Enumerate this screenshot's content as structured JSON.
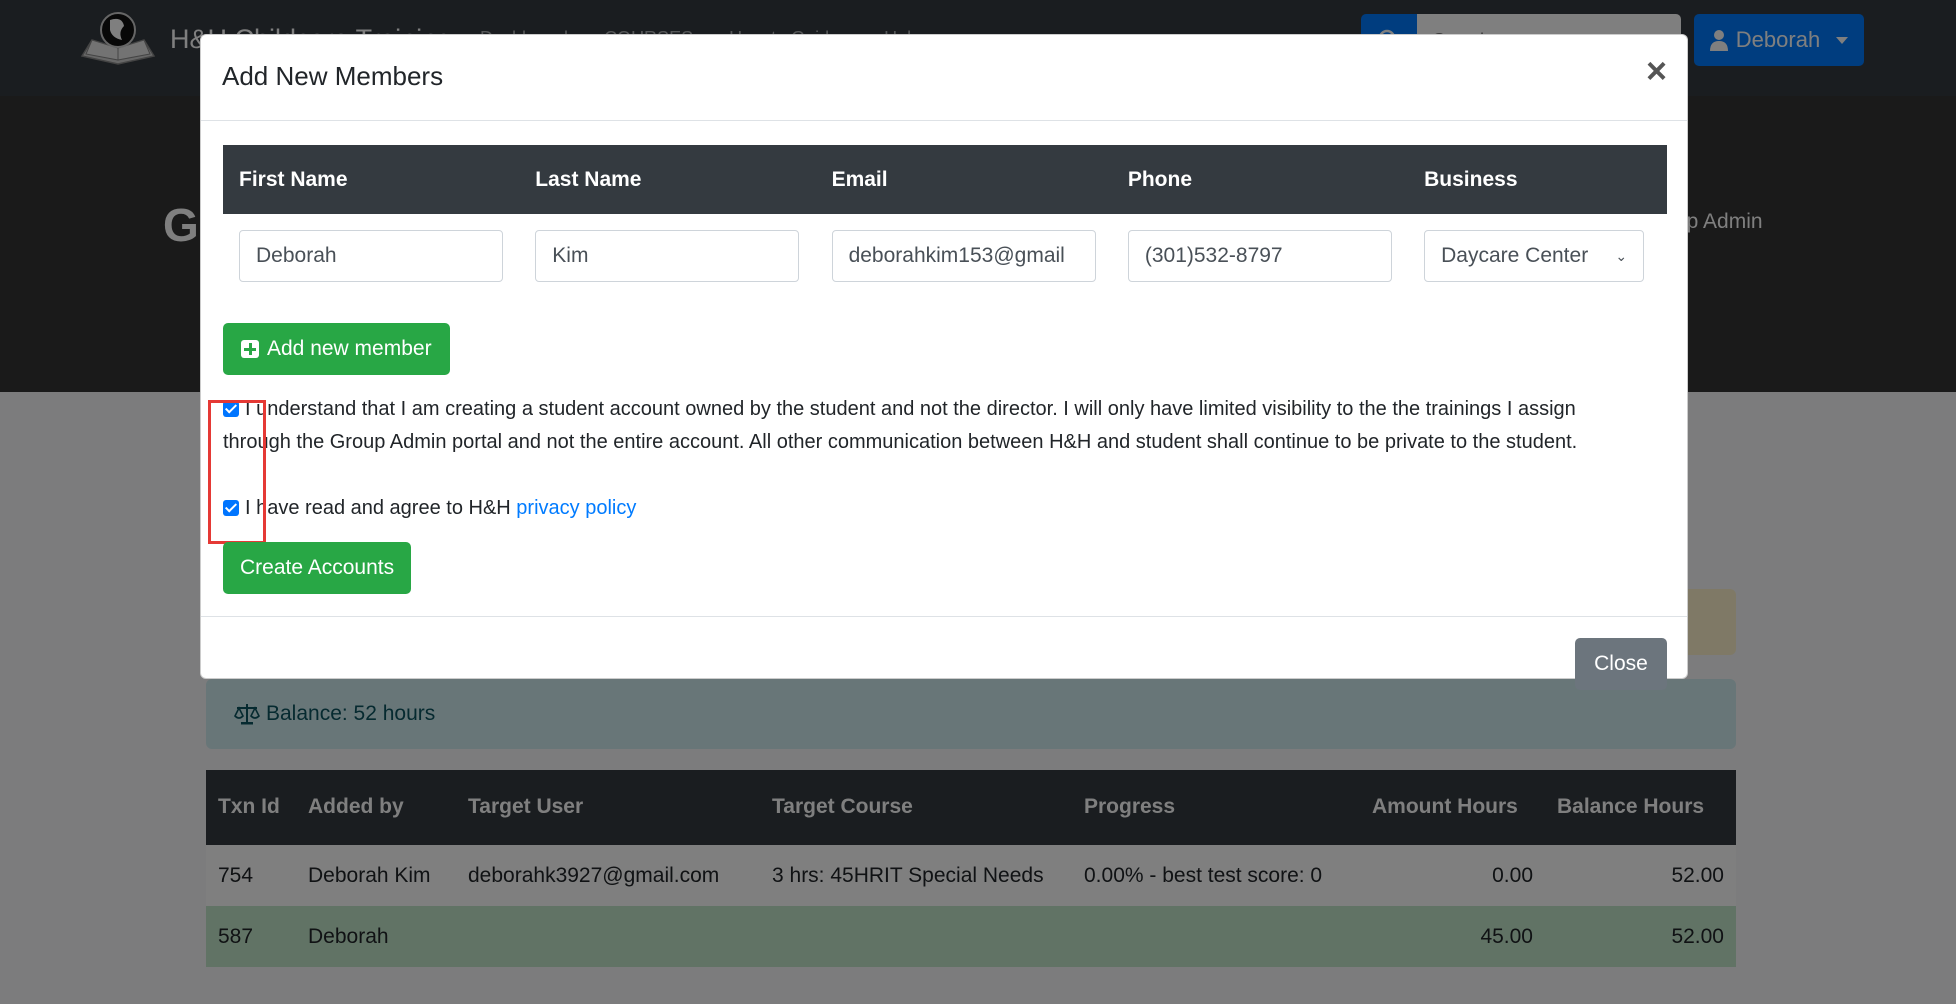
{
  "navbar": {
    "brand_name": "H&H Childcare Training",
    "links": [
      "Dashboard",
      "COURSES",
      "How-to Guides",
      "Help"
    ],
    "search_placeholder": "Search...",
    "user_label": "Deborah"
  },
  "hero": {
    "title": "Group Admin",
    "role": "Group Admin"
  },
  "balance_alert": {
    "icon": "balance-scale-icon",
    "text": "Balance: 52 hours"
  },
  "transactions": {
    "columns": [
      "Txn Id",
      "Added by",
      "Target User",
      "Target Course",
      "Progress",
      "Amount Hours",
      "Balance Hours"
    ],
    "rows": [
      {
        "txn_id": "754",
        "added_by": "Deborah Kim",
        "target_user": "deborahk3927@gmail.com",
        "target_course": "3 hrs: 45HRIT Special Needs",
        "progress": "0.00% - best test score: 0",
        "amount_hours": "0.00",
        "balance_hours": "52.00"
      },
      {
        "txn_id": "587",
        "added_by": "Deborah",
        "target_user": "",
        "target_course": "",
        "progress": "",
        "amount_hours": "45.00",
        "balance_hours": "52.00"
      }
    ]
  },
  "modal": {
    "title": "Add New Members",
    "close_symbol": "×",
    "columns": [
      "First Name",
      "Last Name",
      "Email",
      "Phone",
      "Business"
    ],
    "row": {
      "first_name": "Deborah",
      "last_name": "Kim",
      "email": "deborahkim153@gmail",
      "phone": "(301)532-8797",
      "business": "Daycare Center"
    },
    "add_member_label": "Add new member",
    "consent_text": "I understand that I am creating a student account owned by the student and not the director. I will only have limited visibility to the the trainings I assign through the Group Admin portal and not the entire account. All other communication between H&H and student shall continue to be private to the student.",
    "consent_checked": true,
    "privacy_prefix": "I have read and agree to H&H",
    "privacy_link": "privacy policy",
    "privacy_checked": true,
    "create_label": "Create Accounts",
    "close_label": "Close"
  },
  "colors": {
    "primary": "#007bff",
    "success": "#28a745",
    "secondary": "#6c757d",
    "dark": "#343a40",
    "highlight": "#e53935"
  }
}
